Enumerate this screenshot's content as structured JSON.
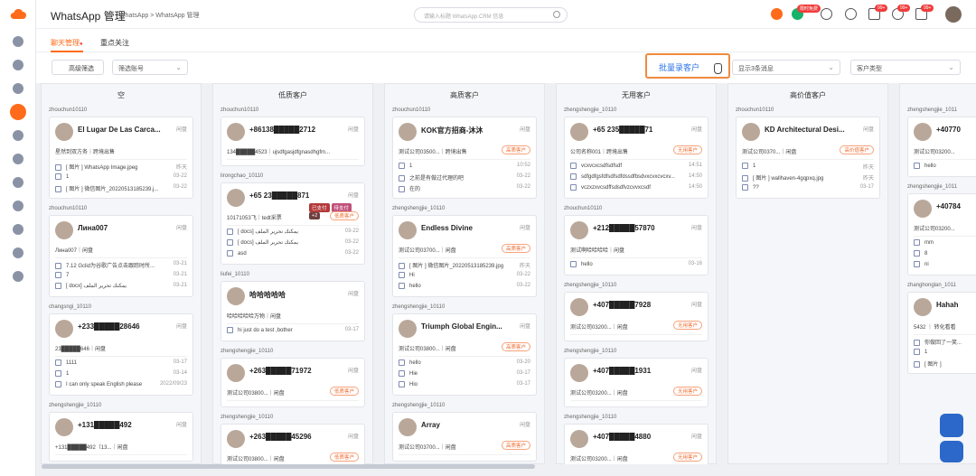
{
  "header": {
    "title": "WhatsApp 管理",
    "breadcrumb": "WhatsApp > WhatsApp 管理",
    "search_placeholder": "请输入标题 WhatsApp.CRM 信息",
    "promo_badge": "限时免费",
    "badges": [
      "99+",
      "99+",
      "99+"
    ]
  },
  "tabs": [
    {
      "label": "聊天管理",
      "active": true
    },
    {
      "label": "重点关注",
      "active": false
    }
  ],
  "filters": {
    "advanced": "高级筛选",
    "account_placeholder": "筛选账号",
    "batch": "批量录客户",
    "show_msgs": "显示3条消息",
    "customer_type": "客户类型"
  },
  "columns": [
    {
      "title": "空",
      "groups": [
        {
          "owner": "zhouchun10110",
          "cards": [
            {
              "name": "El Lugar De Las Carca...",
              "status": "闲盘",
              "sub": "星然到双方务｜跨境出售",
              "tag": "",
              "msgs": [
                {
                  "t": "[ 图片 ] WhatsApp Image.jpeg",
                  "d": "昨天"
                },
                {
                  "t": "1",
                  "d": "03-22"
                },
                {
                  "t": "[ 图片 ] 微信图片_20220513185239.j...",
                  "d": "03-22"
                }
              ]
            }
          ]
        },
        {
          "owner": "zhouchun10110",
          "cards": [
            {
              "name": "Лина007",
              "status": "闲盘",
              "sub": "Лина007｜闲盘",
              "tag": "",
              "msgs": [
                {
                  "t": "7.12 Gclid为谷歌广告点击跟踪时所...",
                  "d": "03-21"
                },
                {
                  "t": "7",
                  "d": "03-21"
                },
                {
                  "t": "[ docx] يمكنك تحرير الملف",
                  "d": "03-21"
                }
              ]
            }
          ]
        },
        {
          "owner": "changsngi_10110",
          "cards": [
            {
              "name": "+233█████28646",
              "status": "闲盘",
              "sub": "23█████646｜闲盘",
              "tag": "",
              "msgs": [
                {
                  "t": "1111",
                  "d": "03-17"
                },
                {
                  "t": "1",
                  "d": "03-14"
                },
                {
                  "t": "I can only speak English please",
                  "d": "2022/09/23"
                }
              ]
            }
          ]
        },
        {
          "owner": "zhengshengjie_10110",
          "cards": [
            {
              "name": "+131█████492",
              "status": "闲盘",
              "sub": "+131█████492（13...｜闲盘",
              "tag": "",
              "msgs": []
            }
          ]
        }
      ]
    },
    {
      "title": "低质客户",
      "groups": [
        {
          "owner": "zhouchun10110",
          "cards": [
            {
              "name": "+86138█████2712",
              "status": "闲盘",
              "sub": "134█████4523｜ujsdfgasjdfgnasdhgfm...",
              "tag": "",
              "msgs": []
            }
          ]
        },
        {
          "owner": "lirongchao_10110",
          "cards": [
            {
              "name": "+65 23█████871",
              "status": "闲盘",
              "sub": "10171053飞｜tedt采票",
              "tag": "低质客户",
              "pills": [
                "已支付",
                "待支付",
                "+2"
              ],
              "msgs": [
                {
                  "t": "[ docs] يمكنك تحرير الملف",
                  "d": "03-22"
                },
                {
                  "t": "[ docs] يمكنك تحرير الملف",
                  "d": "03-22"
                },
                {
                  "t": "asd",
                  "d": "03-22"
                }
              ]
            }
          ]
        },
        {
          "owner": "liufei_10110",
          "cards": [
            {
              "name": "哈哈哈哈哈",
              "status": "闲盘",
              "sub": "哈哈哈哈哈万物｜闲盘",
              "tag": "",
              "msgs": [
                {
                  "t": "hi just do a test ,bother",
                  "d": "03-17"
                }
              ]
            }
          ]
        },
        {
          "owner": "zhengshengjie_10110",
          "cards": [
            {
              "name": "+263█████71972",
              "status": "闲盘",
              "sub": "测试公司03800...｜闲盘",
              "tag": "低质客户",
              "msgs": []
            }
          ]
        },
        {
          "owner": "zhengshengjie_10110",
          "cards": [
            {
              "name": "+263█████45296",
              "status": "闲盘",
              "sub": "测试公司03800...｜闲盘",
              "tag": "低质客户",
              "msgs": []
            }
          ]
        }
      ]
    },
    {
      "title": "高质客户",
      "groups": [
        {
          "owner": "zhouchun10110",
          "cards": [
            {
              "name": "KOK官方招商-沐沐",
              "status": "闲盘",
              "sub": "测试公司03500...｜跨境出售",
              "tag": "高质客户",
              "msgs": [
                {
                  "t": "1",
                  "d": "10:52"
                },
                {
                  "t": "之前是有做过代理的吧",
                  "d": "03-22"
                },
                {
                  "t": "在的",
                  "d": "03-22"
                }
              ]
            }
          ]
        },
        {
          "owner": "zhengshengjie_10110",
          "cards": [
            {
              "name": "Endless Divine",
              "status": "闲盘",
              "sub": "测试公司03700...｜闲盘",
              "tag": "高质客户",
              "msgs": [
                {
                  "t": "[ 图片 ] 微信图片_20220513185239.jpg",
                  "d": "昨天"
                },
                {
                  "t": "Hi",
                  "d": "03-22"
                },
                {
                  "t": "hello",
                  "d": "03-22"
                }
              ]
            }
          ]
        },
        {
          "owner": "zhengshengjie_10110",
          "cards": [
            {
              "name": "Triumph Global Engin...",
              "status": "闲盘",
              "sub": "测试公司03800...｜闲盘",
              "tag": "高质客户",
              "msgs": [
                {
                  "t": "hello",
                  "d": "03-20"
                },
                {
                  "t": "Hie",
                  "d": "03-17"
                },
                {
                  "t": "Hio",
                  "d": "03-17"
                }
              ]
            }
          ]
        },
        {
          "owner": "zhengshengjie_10110",
          "cards": [
            {
              "name": "Array",
              "status": "闲盘",
              "sub": "测试公司03700...｜闲盘",
              "tag": "高质客户",
              "msgs": []
            }
          ]
        }
      ]
    },
    {
      "title": "无用客户",
      "groups": [
        {
          "owner": "zhengshengjie_10110",
          "cards": [
            {
              "name": "+65 235█████71",
              "status": "闲盘",
              "sub": "公司名称001｜跨境出售",
              "tag": "无用客户",
              "msgs": [
                {
                  "t": "vcxvcxcsdfsdfsdf",
                  "d": "14:51"
                },
                {
                  "t": "sdfgdfgsfdfsdfsdfdssdfbsdvxcvxcvcxv...",
                  "d": "14:50"
                },
                {
                  "t": "vczxzxvcsdffsdsdfvzcvvxcsdf",
                  "d": "14:50"
                }
              ]
            }
          ]
        },
        {
          "owner": "zhouchun10110",
          "cards": [
            {
              "name": "+212█████57870",
              "status": "闲盘",
              "sub": "测试啊哈哈哈哈｜闲盘",
              "tag": "",
              "msgs": [
                {
                  "t": "hello",
                  "d": "03-16"
                }
              ]
            }
          ]
        },
        {
          "owner": "zhengshengjie_10110",
          "cards": [
            {
              "name": "+407█████7928",
              "status": "闲盘",
              "sub": "测试公司03200...｜闲盘",
              "tag": "无用客户",
              "msgs": []
            }
          ]
        },
        {
          "owner": "zhengshengjie_10110",
          "cards": [
            {
              "name": "+407█████1931",
              "status": "闲盘",
              "sub": "测试公司03200...｜闲盘",
              "tag": "无用客户",
              "msgs": []
            }
          ]
        },
        {
          "owner": "zhengshengjie_10110",
          "cards": [
            {
              "name": "+407█████4880",
              "status": "闲盘",
              "sub": "测试公司03200...｜闲盘",
              "tag": "无用客户",
              "msgs": []
            }
          ]
        }
      ]
    },
    {
      "title": "高价值客户",
      "groups": [
        {
          "owner": "zhouchun10110",
          "cards": [
            {
              "name": "KD Architectural Desi...",
              "status": "闲盘",
              "sub": "测试公司0370...｜闲盘",
              "tag": "高价值客户",
              "msgs": [
                {
                  "t": "1",
                  "d": "昨天"
                },
                {
                  "t": "[ 图片 ] wallhaven-4gqpxq.jpg",
                  "d": "昨天"
                },
                {
                  "t": "??",
                  "d": "03-17"
                }
              ]
            }
          ]
        }
      ]
    },
    {
      "title": "",
      "groups": [
        {
          "owner": "zhengshengjie_1011",
          "cards": [
            {
              "name": "+40770",
              "status": "",
              "sub": "测试公司03200...",
              "tag": "",
              "msgs": [
                {
                  "t": "hello",
                  "d": ""
                }
              ]
            }
          ]
        },
        {
          "owner": "zhengshengjie_1011",
          "cards": [
            {
              "name": "+40784",
              "status": "",
              "sub": "测试公司03200...",
              "tag": "",
              "msgs": [
                {
                  "t": "mm",
                  "d": ""
                },
                {
                  "t": "8",
                  "d": ""
                },
                {
                  "t": "ni",
                  "d": ""
                }
              ]
            }
          ]
        },
        {
          "owner": "zhanghonglan_1011",
          "cards": [
            {
              "name": "Hahah",
              "status": "",
              "sub": "5432 ｜ 转化看看",
              "tag": "",
              "msgs": [
                {
                  "t": "你做回了一笑...",
                  "d": ""
                },
                {
                  "t": "1",
                  "d": ""
                },
                {
                  "t": "[ 图片 ]",
                  "d": ""
                }
              ]
            }
          ]
        }
      ]
    }
  ],
  "colors": {
    "accent": "#ff6b1a",
    "link": "#2b74e6",
    "tag": "#ef6a2e"
  }
}
